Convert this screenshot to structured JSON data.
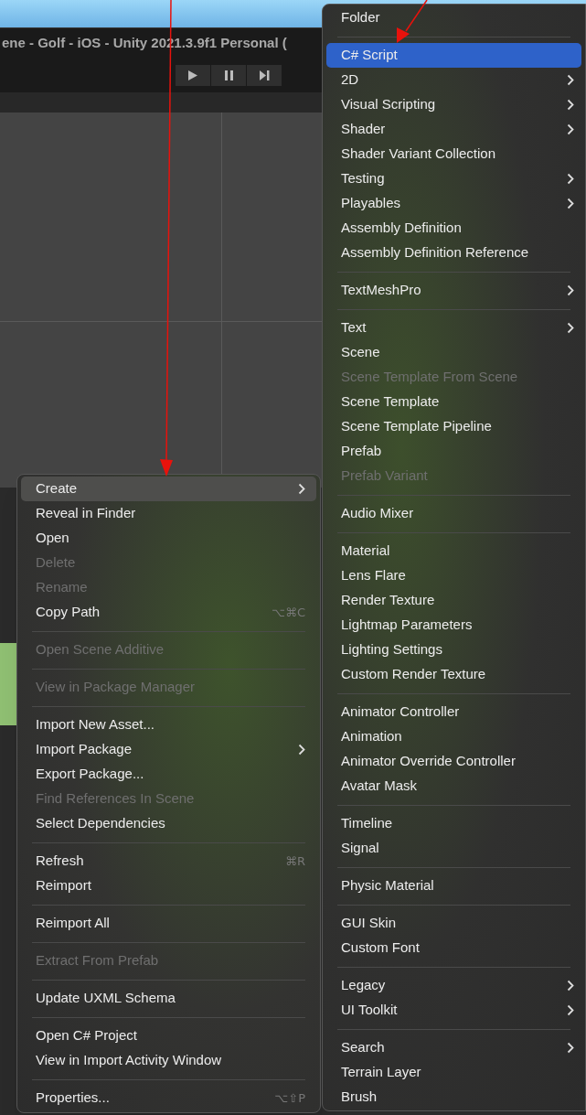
{
  "window": {
    "title": "ene - Golf - iOS - Unity 2021.3.9f1 Personal ("
  },
  "context_menu": {
    "items": [
      {
        "kind": "item",
        "label": "Create",
        "submenu": true,
        "selected": true,
        "disabled": false
      },
      {
        "kind": "item",
        "label": "Reveal in Finder",
        "submenu": false,
        "selected": false,
        "disabled": false
      },
      {
        "kind": "item",
        "label": "Open",
        "submenu": false,
        "selected": false,
        "disabled": false
      },
      {
        "kind": "item",
        "label": "Delete",
        "submenu": false,
        "selected": false,
        "disabled": true
      },
      {
        "kind": "item",
        "label": "Rename",
        "submenu": false,
        "selected": false,
        "disabled": true
      },
      {
        "kind": "item",
        "label": "Copy Path",
        "shortcut": "⌥⌘C",
        "submenu": false,
        "selected": false,
        "disabled": false
      },
      {
        "kind": "separator"
      },
      {
        "kind": "item",
        "label": "Open Scene Additive",
        "submenu": false,
        "selected": false,
        "disabled": true
      },
      {
        "kind": "separator"
      },
      {
        "kind": "item",
        "label": "View in Package Manager",
        "submenu": false,
        "selected": false,
        "disabled": true
      },
      {
        "kind": "separator"
      },
      {
        "kind": "item",
        "label": "Import New Asset...",
        "submenu": false,
        "selected": false,
        "disabled": false
      },
      {
        "kind": "item",
        "label": "Import Package",
        "submenu": true,
        "selected": false,
        "disabled": false
      },
      {
        "kind": "item",
        "label": "Export Package...",
        "submenu": false,
        "selected": false,
        "disabled": false
      },
      {
        "kind": "item",
        "label": "Find References In Scene",
        "submenu": false,
        "selected": false,
        "disabled": true
      },
      {
        "kind": "item",
        "label": "Select Dependencies",
        "submenu": false,
        "selected": false,
        "disabled": false
      },
      {
        "kind": "separator"
      },
      {
        "kind": "item",
        "label": "Refresh",
        "shortcut": "⌘R",
        "submenu": false,
        "selected": false,
        "disabled": false
      },
      {
        "kind": "item",
        "label": "Reimport",
        "submenu": false,
        "selected": false,
        "disabled": false
      },
      {
        "kind": "separator"
      },
      {
        "kind": "item",
        "label": "Reimport All",
        "submenu": false,
        "selected": false,
        "disabled": false
      },
      {
        "kind": "separator"
      },
      {
        "kind": "item",
        "label": "Extract From Prefab",
        "submenu": false,
        "selected": false,
        "disabled": true
      },
      {
        "kind": "separator"
      },
      {
        "kind": "item",
        "label": "Update UXML Schema",
        "submenu": false,
        "selected": false,
        "disabled": false
      },
      {
        "kind": "separator"
      },
      {
        "kind": "item",
        "label": "Open C# Project",
        "submenu": false,
        "selected": false,
        "disabled": false
      },
      {
        "kind": "item",
        "label": "View in Import Activity Window",
        "submenu": false,
        "selected": false,
        "disabled": false
      },
      {
        "kind": "separator"
      },
      {
        "kind": "item",
        "label": "Properties...",
        "shortcut": "⌥⇧P",
        "submenu": false,
        "selected": false,
        "disabled": false
      }
    ]
  },
  "create_submenu": {
    "items": [
      {
        "kind": "item",
        "label": "Folder",
        "submenu": false,
        "selected": false,
        "disabled": false
      },
      {
        "kind": "separator"
      },
      {
        "kind": "item",
        "label": "C# Script",
        "submenu": false,
        "selected": true,
        "disabled": false
      },
      {
        "kind": "item",
        "label": "2D",
        "submenu": true,
        "selected": false,
        "disabled": false
      },
      {
        "kind": "item",
        "label": "Visual Scripting",
        "submenu": true,
        "selected": false,
        "disabled": false
      },
      {
        "kind": "item",
        "label": "Shader",
        "submenu": true,
        "selected": false,
        "disabled": false
      },
      {
        "kind": "item",
        "label": "Shader Variant Collection",
        "submenu": false,
        "selected": false,
        "disabled": false
      },
      {
        "kind": "item",
        "label": "Testing",
        "submenu": true,
        "selected": false,
        "disabled": false
      },
      {
        "kind": "item",
        "label": "Playables",
        "submenu": true,
        "selected": false,
        "disabled": false
      },
      {
        "kind": "item",
        "label": "Assembly Definition",
        "submenu": false,
        "selected": false,
        "disabled": false
      },
      {
        "kind": "item",
        "label": "Assembly Definition Reference",
        "submenu": false,
        "selected": false,
        "disabled": false
      },
      {
        "kind": "separator"
      },
      {
        "kind": "item",
        "label": "TextMeshPro",
        "submenu": true,
        "selected": false,
        "disabled": false
      },
      {
        "kind": "separator"
      },
      {
        "kind": "item",
        "label": "Text",
        "submenu": true,
        "selected": false,
        "disabled": false
      },
      {
        "kind": "item",
        "label": "Scene",
        "submenu": false,
        "selected": false,
        "disabled": false
      },
      {
        "kind": "item",
        "label": "Scene Template From Scene",
        "submenu": false,
        "selected": false,
        "disabled": true
      },
      {
        "kind": "item",
        "label": "Scene Template",
        "submenu": false,
        "selected": false,
        "disabled": false
      },
      {
        "kind": "item",
        "label": "Scene Template Pipeline",
        "submenu": false,
        "selected": false,
        "disabled": false
      },
      {
        "kind": "item",
        "label": "Prefab",
        "submenu": false,
        "selected": false,
        "disabled": false
      },
      {
        "kind": "item",
        "label": "Prefab Variant",
        "submenu": false,
        "selected": false,
        "disabled": true
      },
      {
        "kind": "separator"
      },
      {
        "kind": "item",
        "label": "Audio Mixer",
        "submenu": false,
        "selected": false,
        "disabled": false
      },
      {
        "kind": "separator"
      },
      {
        "kind": "item",
        "label": "Material",
        "submenu": false,
        "selected": false,
        "disabled": false
      },
      {
        "kind": "item",
        "label": "Lens Flare",
        "submenu": false,
        "selected": false,
        "disabled": false
      },
      {
        "kind": "item",
        "label": "Render Texture",
        "submenu": false,
        "selected": false,
        "disabled": false
      },
      {
        "kind": "item",
        "label": "Lightmap Parameters",
        "submenu": false,
        "selected": false,
        "disabled": false
      },
      {
        "kind": "item",
        "label": "Lighting Settings",
        "submenu": false,
        "selected": false,
        "disabled": false
      },
      {
        "kind": "item",
        "label": "Custom Render Texture",
        "submenu": false,
        "selected": false,
        "disabled": false
      },
      {
        "kind": "separator"
      },
      {
        "kind": "item",
        "label": "Animator Controller",
        "submenu": false,
        "selected": false,
        "disabled": false
      },
      {
        "kind": "item",
        "label": "Animation",
        "submenu": false,
        "selected": false,
        "disabled": false
      },
      {
        "kind": "item",
        "label": "Animator Override Controller",
        "submenu": false,
        "selected": false,
        "disabled": false
      },
      {
        "kind": "item",
        "label": "Avatar Mask",
        "submenu": false,
        "selected": false,
        "disabled": false
      },
      {
        "kind": "separator"
      },
      {
        "kind": "item",
        "label": "Timeline",
        "submenu": false,
        "selected": false,
        "disabled": false
      },
      {
        "kind": "item",
        "label": "Signal",
        "submenu": false,
        "selected": false,
        "disabled": false
      },
      {
        "kind": "separator"
      },
      {
        "kind": "item",
        "label": "Physic Material",
        "submenu": false,
        "selected": false,
        "disabled": false
      },
      {
        "kind": "separator"
      },
      {
        "kind": "item",
        "label": "GUI Skin",
        "submenu": false,
        "selected": false,
        "disabled": false
      },
      {
        "kind": "item",
        "label": "Custom Font",
        "submenu": false,
        "selected": false,
        "disabled": false
      },
      {
        "kind": "separator"
      },
      {
        "kind": "item",
        "label": "Legacy",
        "submenu": true,
        "selected": false,
        "disabled": false
      },
      {
        "kind": "item",
        "label": "UI Toolkit",
        "submenu": true,
        "selected": false,
        "disabled": false
      },
      {
        "kind": "separator"
      },
      {
        "kind": "item",
        "label": "Search",
        "submenu": true,
        "selected": false,
        "disabled": false
      },
      {
        "kind": "item",
        "label": "Terrain Layer",
        "submenu": false,
        "selected": false,
        "disabled": false
      },
      {
        "kind": "item",
        "label": "Brush",
        "submenu": false,
        "selected": false,
        "disabled": false
      }
    ]
  }
}
